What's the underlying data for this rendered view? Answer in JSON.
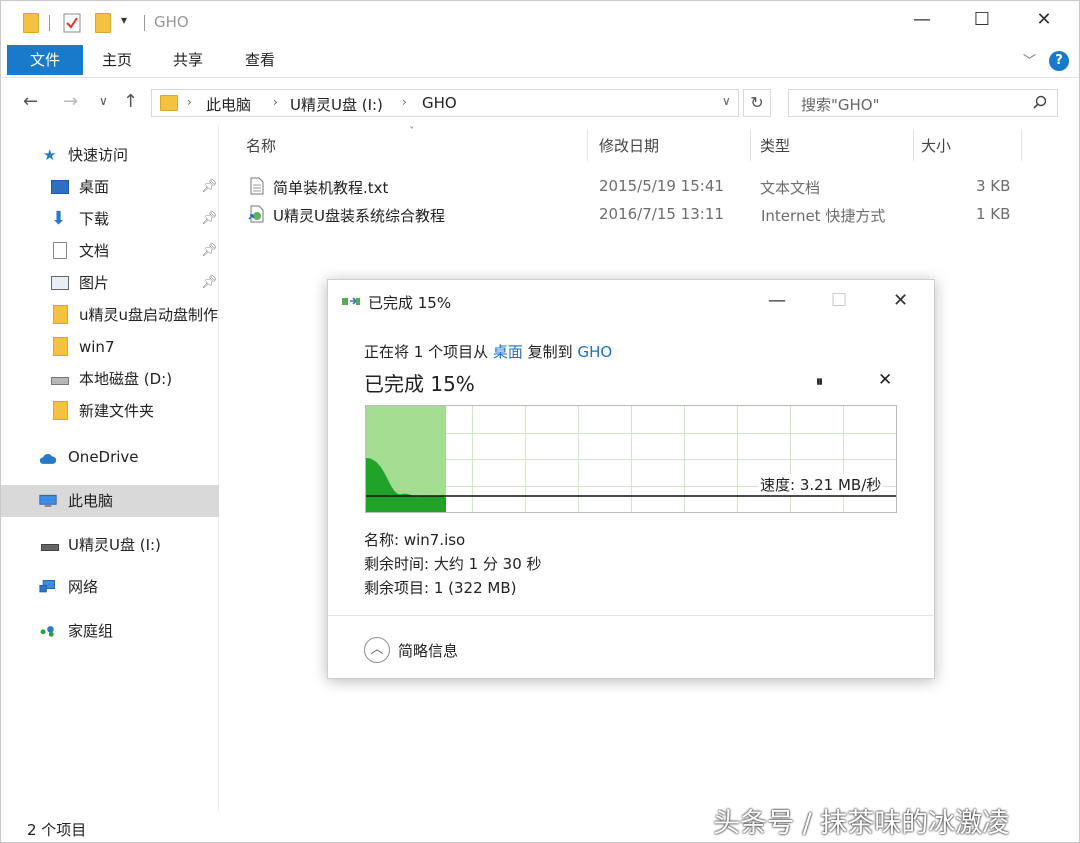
{
  "window": {
    "title": "GHO",
    "controls": {
      "minimize": "—",
      "maximize": "☐",
      "close": "✕"
    }
  },
  "ribbon": {
    "tabs": [
      "文件",
      "主页",
      "共享",
      "查看"
    ],
    "help_label": "?"
  },
  "address_bar": {
    "crumbs": [
      "此电脑",
      "U精灵U盘 (I:)",
      "GHO"
    ],
    "search_placeholder": "搜索\"GHO\""
  },
  "sidebar": {
    "items": [
      {
        "label": "快速访问",
        "icon": "star-icon"
      },
      {
        "label": "桌面",
        "icon": "desktop-icon",
        "pinned": true
      },
      {
        "label": "下载",
        "icon": "download-icon",
        "pinned": true
      },
      {
        "label": "文档",
        "icon": "document-icon",
        "pinned": true
      },
      {
        "label": "图片",
        "icon": "picture-icon",
        "pinned": true
      },
      {
        "label": "u精灵u盘启动盘制作",
        "icon": "folder-icon"
      },
      {
        "label": "win7",
        "icon": "folder-icon"
      },
      {
        "label": "本地磁盘 (D:)",
        "icon": "drive-icon"
      },
      {
        "label": "新建文件夹",
        "icon": "folder-icon"
      },
      {
        "label": "OneDrive",
        "icon": "cloud-icon"
      },
      {
        "label": "此电脑",
        "icon": "computer-icon",
        "selected": true
      },
      {
        "label": "U精灵U盘 (I:)",
        "icon": "usb-drive-icon"
      },
      {
        "label": "网络",
        "icon": "network-icon"
      },
      {
        "label": "家庭组",
        "icon": "homegroup-icon"
      }
    ]
  },
  "file_list": {
    "columns": [
      "名称",
      "修改日期",
      "类型",
      "大小"
    ],
    "rows": [
      {
        "name": "简单装机教程.txt",
        "date": "2015/5/19 15:41",
        "type": "文本文档",
        "size": "3 KB",
        "icon": "text-file-icon"
      },
      {
        "name": "U精灵U盘装系统综合教程",
        "date": "2016/7/15 13:11",
        "type": "Internet 快捷方式",
        "size": "1 KB",
        "icon": "internet-shortcut-icon"
      }
    ]
  },
  "status_bar": {
    "item_count": "2 个项目"
  },
  "copy_dialog": {
    "title": "已完成 15%",
    "line1_prefix": "正在将 1 个项目从",
    "source": "桌面",
    "line1_mid": "复制到",
    "destination": "GHO",
    "status": "已完成 15%",
    "progress": 0.15,
    "speed": "速度: 3.21 MB/秒",
    "name_line": "名称: win7.iso",
    "time_line": "剩余时间: 大约 1 分 30 秒",
    "items_line": "剩余项目: 1 (322 MB)",
    "details_toggle": "简略信息",
    "pause_label": "⏸",
    "cancel_label": "✕",
    "controls": {
      "minimize": "—",
      "maximize": "☐",
      "close": "✕"
    }
  },
  "watermark": "头条号 / 抹茶味的冰激凌"
}
